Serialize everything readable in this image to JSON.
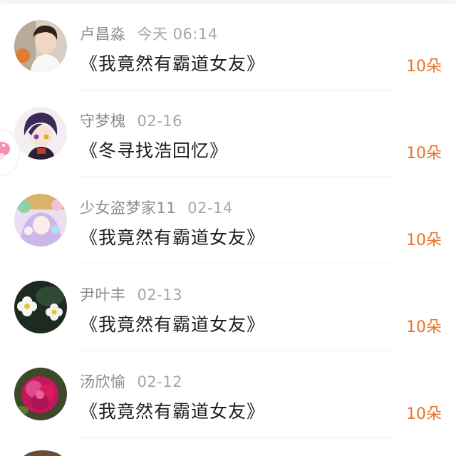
{
  "rows": [
    {
      "name": "卢昌淼",
      "date": "今天 06:14",
      "title": "《我竟然有霸道女友》",
      "count": "10朵",
      "avatar_icon": "boy-portrait-avatar"
    },
    {
      "name": "守梦槐",
      "date": "02-16",
      "title": "《冬寻找浩回忆》",
      "count": "10朵",
      "avatar_icon": "anime-boy-avatar"
    },
    {
      "name": "少女盗梦家11",
      "date": "02-14",
      "title": "《我竟然有霸道女友》",
      "count": "10朵",
      "avatar_icon": "anime-girl-avatar"
    },
    {
      "name": "尹叶丰",
      "date": "02-13",
      "title": "《我竟然有霸道女友》",
      "count": "10朵",
      "avatar_icon": "white-flowers-avatar"
    },
    {
      "name": "汤欣愉",
      "date": "02-12",
      "title": "《我竟然有霸道女友》",
      "count": "10朵",
      "avatar_icon": "pink-peony-avatar"
    }
  ],
  "colors": {
    "count": "#e8732a",
    "name": "#8c8c8c",
    "title": "#1e1e1e"
  },
  "side_badge_icon": "pink-mushroom-icon"
}
